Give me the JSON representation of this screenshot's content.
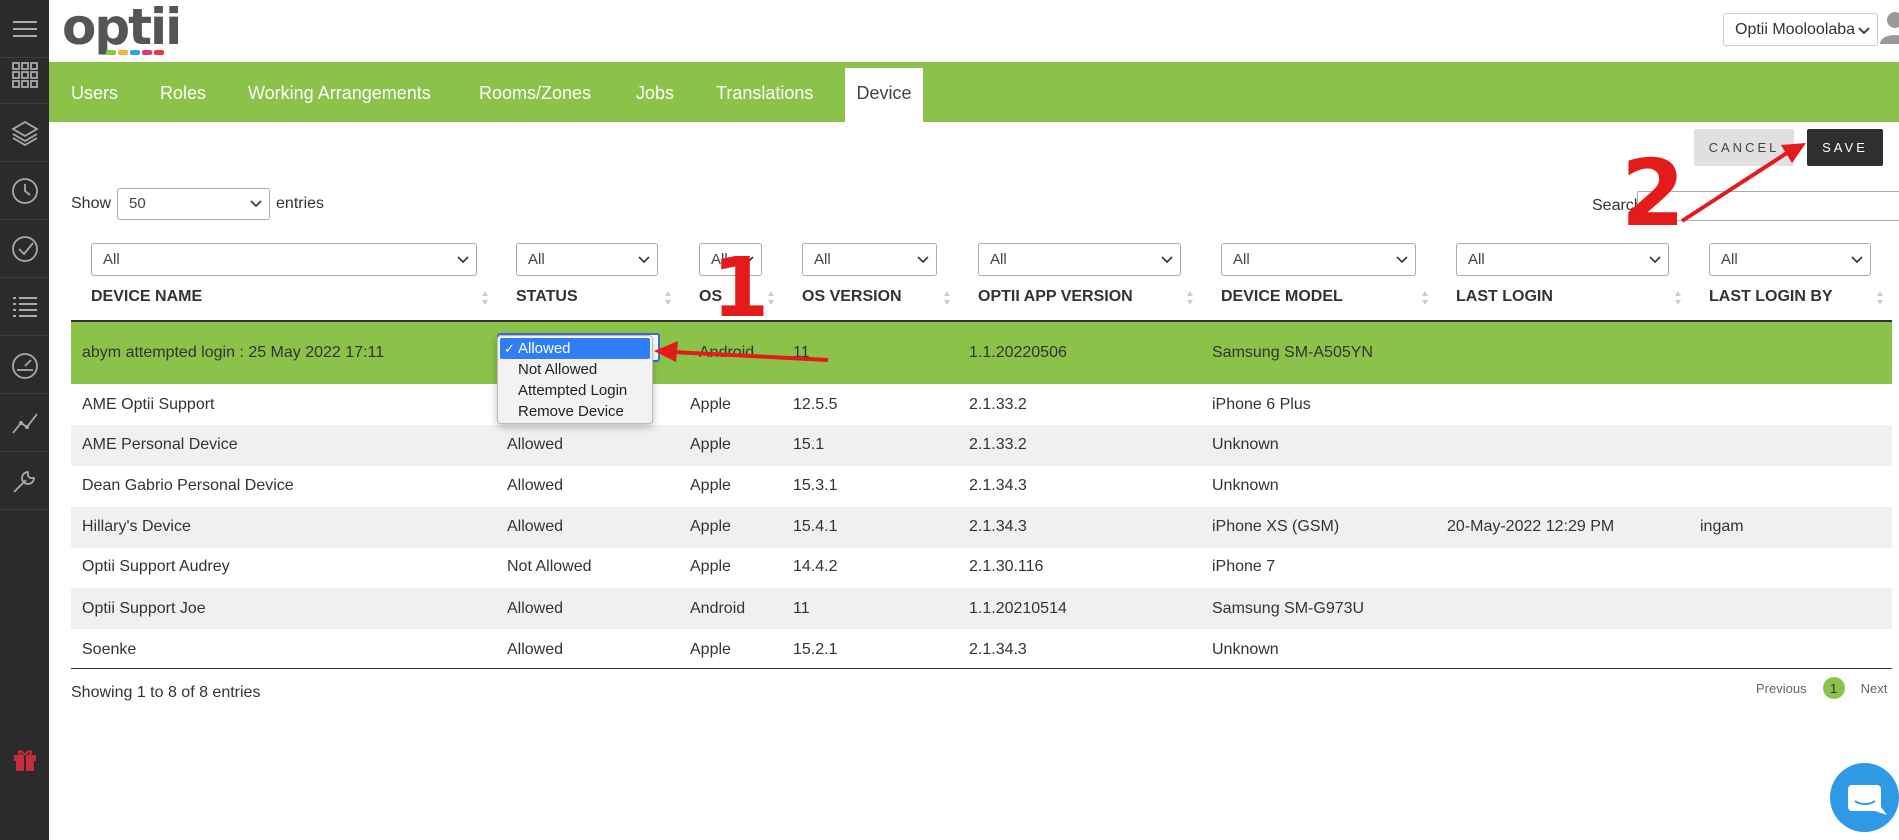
{
  "sidebar": {
    "icons": [
      "menu-icon",
      "apps-grid-icon",
      "layers-icon",
      "clock-icon",
      "check-circle-icon",
      "list-icon",
      "dashboard-gauge-icon",
      "trend-line-icon",
      "wrench-icon",
      "gift-icon"
    ]
  },
  "header": {
    "logo": "optii",
    "property_select": "Optii Mooloolaba"
  },
  "nav": {
    "tabs": [
      {
        "label": "Users"
      },
      {
        "label": "Roles"
      },
      {
        "label": "Working Arrangements"
      },
      {
        "label": "Rooms/Zones"
      },
      {
        "label": "Jobs"
      },
      {
        "label": "Translations"
      },
      {
        "label": "Device",
        "active": true
      }
    ]
  },
  "actions": {
    "cancel": "CANCEL",
    "save": "SAVE"
  },
  "table_controls": {
    "show_label": "Show",
    "entries_value": "50",
    "entries_label": "entries",
    "search_label": "Search:"
  },
  "filters": [
    "All",
    "All",
    "All",
    "All",
    "All",
    "All",
    "All",
    "All"
  ],
  "columns": [
    "DEVICE NAME",
    "STATUS",
    "OS",
    "OS VERSION",
    "OPTII APP VERSION",
    "DEVICE MODEL",
    "LAST LOGIN",
    "LAST LOGIN BY"
  ],
  "rows": [
    {
      "name": "abym attempted login : 25 May 2022 17:11",
      "status": "",
      "os": "Android",
      "os_version": "11",
      "app_version": "1.1.20220506",
      "model": "Samsung SM-A505YN",
      "last_login": "",
      "last_login_by": ""
    },
    {
      "name": "AME Optii Support",
      "status": "",
      "os": "Apple",
      "os_version": "12.5.5",
      "app_version": "2.1.33.2",
      "model": "iPhone 6 Plus",
      "last_login": "",
      "last_login_by": ""
    },
    {
      "name": "AME Personal Device",
      "status": "Allowed",
      "os": "Apple",
      "os_version": "15.1",
      "app_version": "2.1.33.2",
      "model": "Unknown",
      "last_login": "",
      "last_login_by": ""
    },
    {
      "name": "Dean Gabrio Personal Device",
      "status": "Allowed",
      "os": "Apple",
      "os_version": "15.3.1",
      "app_version": "2.1.34.3",
      "model": "Unknown",
      "last_login": "",
      "last_login_by": ""
    },
    {
      "name": "Hillary's Device",
      "status": "Allowed",
      "os": "Apple",
      "os_version": "15.4.1",
      "app_version": "2.1.34.3",
      "model": "iPhone XS (GSM)",
      "last_login": "20-May-2022 12:29 PM",
      "last_login_by": "ingam"
    },
    {
      "name": "Optii Support Audrey",
      "status": "Not Allowed",
      "os": "Apple",
      "os_version": "14.4.2",
      "app_version": "2.1.30.116",
      "model": "iPhone 7",
      "last_login": "",
      "last_login_by": ""
    },
    {
      "name": "Optii Support Joe",
      "status": "Allowed",
      "os": "Android",
      "os_version": "11",
      "app_version": "1.1.20210514",
      "model": "Samsung SM-G973U",
      "last_login": "",
      "last_login_by": ""
    },
    {
      "name": "Soenke",
      "status": "Allowed",
      "os": "Apple",
      "os_version": "15.2.1",
      "app_version": "2.1.34.3",
      "model": "Unknown",
      "last_login": "",
      "last_login_by": ""
    }
  ],
  "status_dropdown": {
    "check": "✓",
    "options": [
      "Allowed",
      "Not Allowed",
      "Attempted Login",
      "Remove Device"
    ],
    "selected": "Allowed"
  },
  "footer": {
    "info": "Showing 1 to 8 of 8 entries",
    "previous": "Previous",
    "page": "1",
    "next": "Next"
  },
  "annotations": {
    "step1": "1",
    "step2": "2",
    "color": "#e31b1b"
  },
  "colors": {
    "brand_green": "#8bc34a",
    "rail": "#2b2b2b",
    "save_button": "#2f2f2f",
    "chat": "#2e9ae6"
  }
}
